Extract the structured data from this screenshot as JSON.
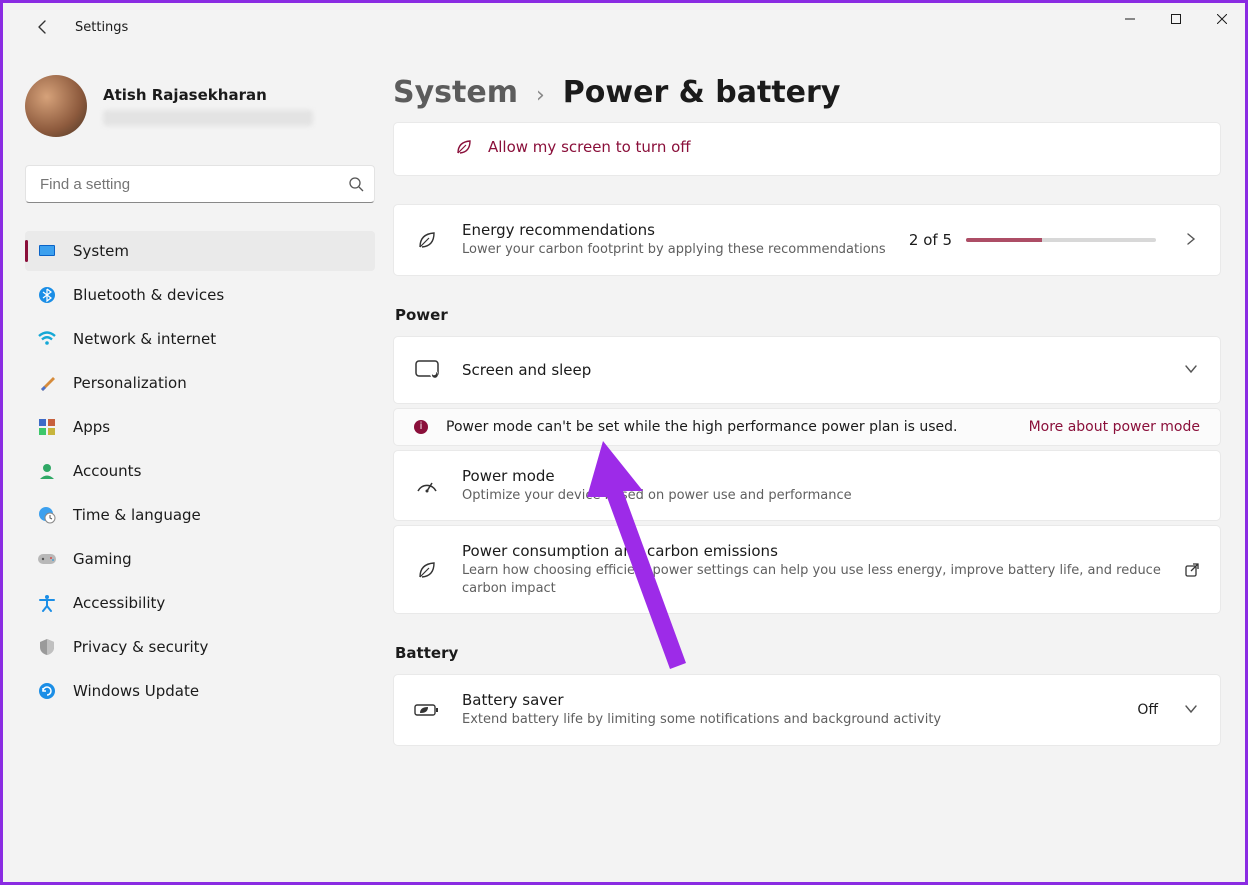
{
  "window": {
    "title": "Settings"
  },
  "profile": {
    "name": "Atish Rajasekharan"
  },
  "search": {
    "placeholder": "Find a setting"
  },
  "nav": {
    "items": [
      {
        "label": "System"
      },
      {
        "label": "Bluetooth & devices"
      },
      {
        "label": "Network & internet"
      },
      {
        "label": "Personalization"
      },
      {
        "label": "Apps"
      },
      {
        "label": "Accounts"
      },
      {
        "label": "Time & language"
      },
      {
        "label": "Gaming"
      },
      {
        "label": "Accessibility"
      },
      {
        "label": "Privacy & security"
      },
      {
        "label": "Windows Update"
      }
    ]
  },
  "breadcrumb": {
    "parent": "System",
    "current": "Power & battery"
  },
  "suggest": {
    "label": "Allow my screen to turn off"
  },
  "energy": {
    "title": "Energy recommendations",
    "subtitle": "Lower your carbon footprint by applying these recommendations",
    "progress_label": "2 of 5",
    "progress_pct": 40
  },
  "sections": {
    "power": "Power",
    "battery": "Battery"
  },
  "screen_sleep": {
    "title": "Screen and sleep"
  },
  "notice": {
    "text": "Power mode can't be set while the high performance power plan is used.",
    "link": "More about power mode"
  },
  "power_mode": {
    "title": "Power mode",
    "subtitle": "Optimize your device based on power use and performance"
  },
  "consumption": {
    "title": "Power consumption and carbon emissions",
    "subtitle": "Learn how choosing efficient power settings can help you use less energy, improve battery life, and reduce carbon impact"
  },
  "battery_saver": {
    "title": "Battery saver",
    "subtitle": "Extend battery life by limiting some notifications and background activity",
    "value": "Off"
  }
}
